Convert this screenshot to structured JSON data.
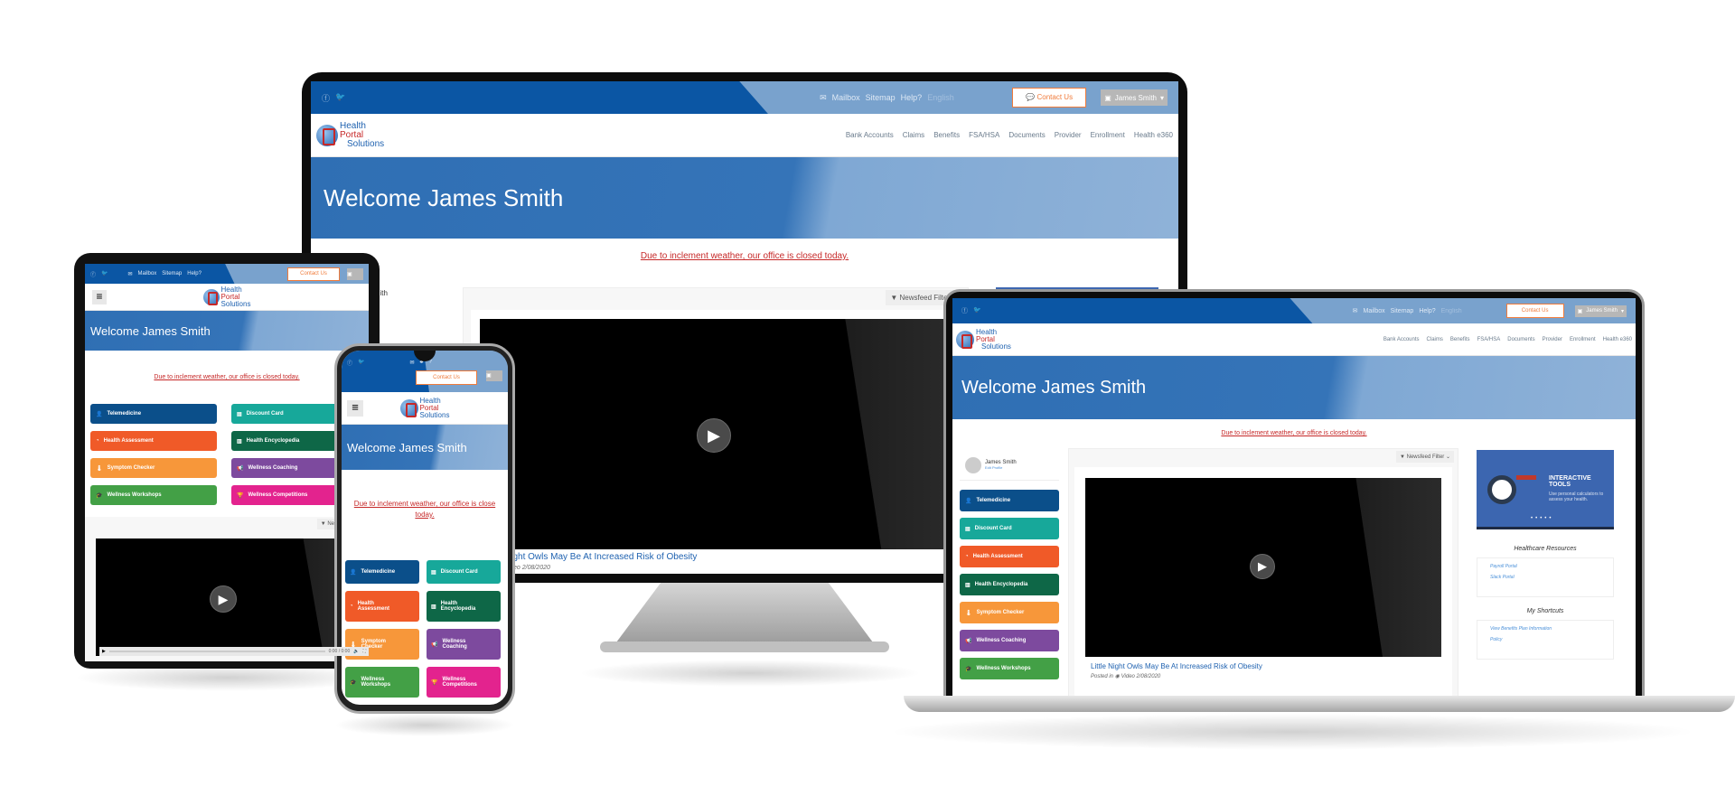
{
  "topbar": {
    "social": [
      "facebook",
      "twitter"
    ],
    "mailbox": "Mailbox",
    "sitemap": "Sitemap",
    "help": "Help?",
    "language": "English",
    "contact": "Contact Us",
    "user": "James Smith"
  },
  "logo": {
    "line1": "Health",
    "line2": "Portal",
    "line3": "Solutions",
    "url": "www.hpsglobal.net"
  },
  "nav": [
    "Bank Accounts",
    "Claims",
    "Benefits",
    "FSA/HSA",
    "Documents",
    "Provider",
    "Enrollment",
    "Health e360"
  ],
  "hero": {
    "title": "Welcome James Smith"
  },
  "alert": "Due to inclement weather, our office is closed today.",
  "alert_mobile": [
    "Due to inclement weather, our office is close",
    "today."
  ],
  "profile": {
    "name": "James Smith",
    "edit": "Edit Profile"
  },
  "tiles": [
    {
      "label": "Telemedicine",
      "label_m": [
        "Telemedicine"
      ],
      "icon": "doctor-icon",
      "glyph": "👤"
    },
    {
      "label": "Discount Card",
      "label_m": [
        "Discount Card"
      ],
      "icon": "card-icon",
      "glyph": "▤"
    },
    {
      "label": "Health Assessment",
      "label_m": [
        "Health",
        "Assessment"
      ],
      "icon": "gauge-icon",
      "glyph": "◔"
    },
    {
      "label": "Health Encyclopedia",
      "label_m": [
        "Health",
        "Encyclopedia"
      ],
      "icon": "book-icon",
      "glyph": "▥"
    },
    {
      "label": "Symptom Checker",
      "label_m": [
        "Symptom",
        "Checker"
      ],
      "icon": "thermometer-icon",
      "glyph": "🌡"
    },
    {
      "label": "Wellness Coaching",
      "label_m": [
        "Wellness",
        "Coaching"
      ],
      "icon": "megaphone-icon",
      "glyph": "📢"
    },
    {
      "label": "Wellness Workshops",
      "label_m": [
        "Wellness",
        "Workshops"
      ],
      "icon": "graduation-cap-icon",
      "glyph": "🎓"
    },
    {
      "label": "Wellness Competitions",
      "label_m": [
        "Wellness",
        "Competitions"
      ],
      "icon": "trophy-icon",
      "glyph": "🏆"
    }
  ],
  "newsfeed": {
    "filter": "Newsfeed Filter",
    "post_title": "Little Night Owls May Be At Increased Risk of Obesity",
    "post_title_cut": "Night Owls May Be At Increased Risk of Obesity",
    "post_meta": "Posted in",
    "post_type": "Video",
    "post_date": "2/08/2020",
    "time": "0:00 / 0:00"
  },
  "sidebar_right": {
    "banner_title": "INTERACTIVE TOOLS",
    "banner_text": "Use personal calculators to assess your health.",
    "resources_title": "Healthcare Resources",
    "resources": [
      "Payroll Portal",
      "Slack Portal"
    ],
    "shortcuts_title": "My Shortcuts",
    "shortcuts": [
      "View Benefits Plan Information",
      "Policy"
    ]
  }
}
